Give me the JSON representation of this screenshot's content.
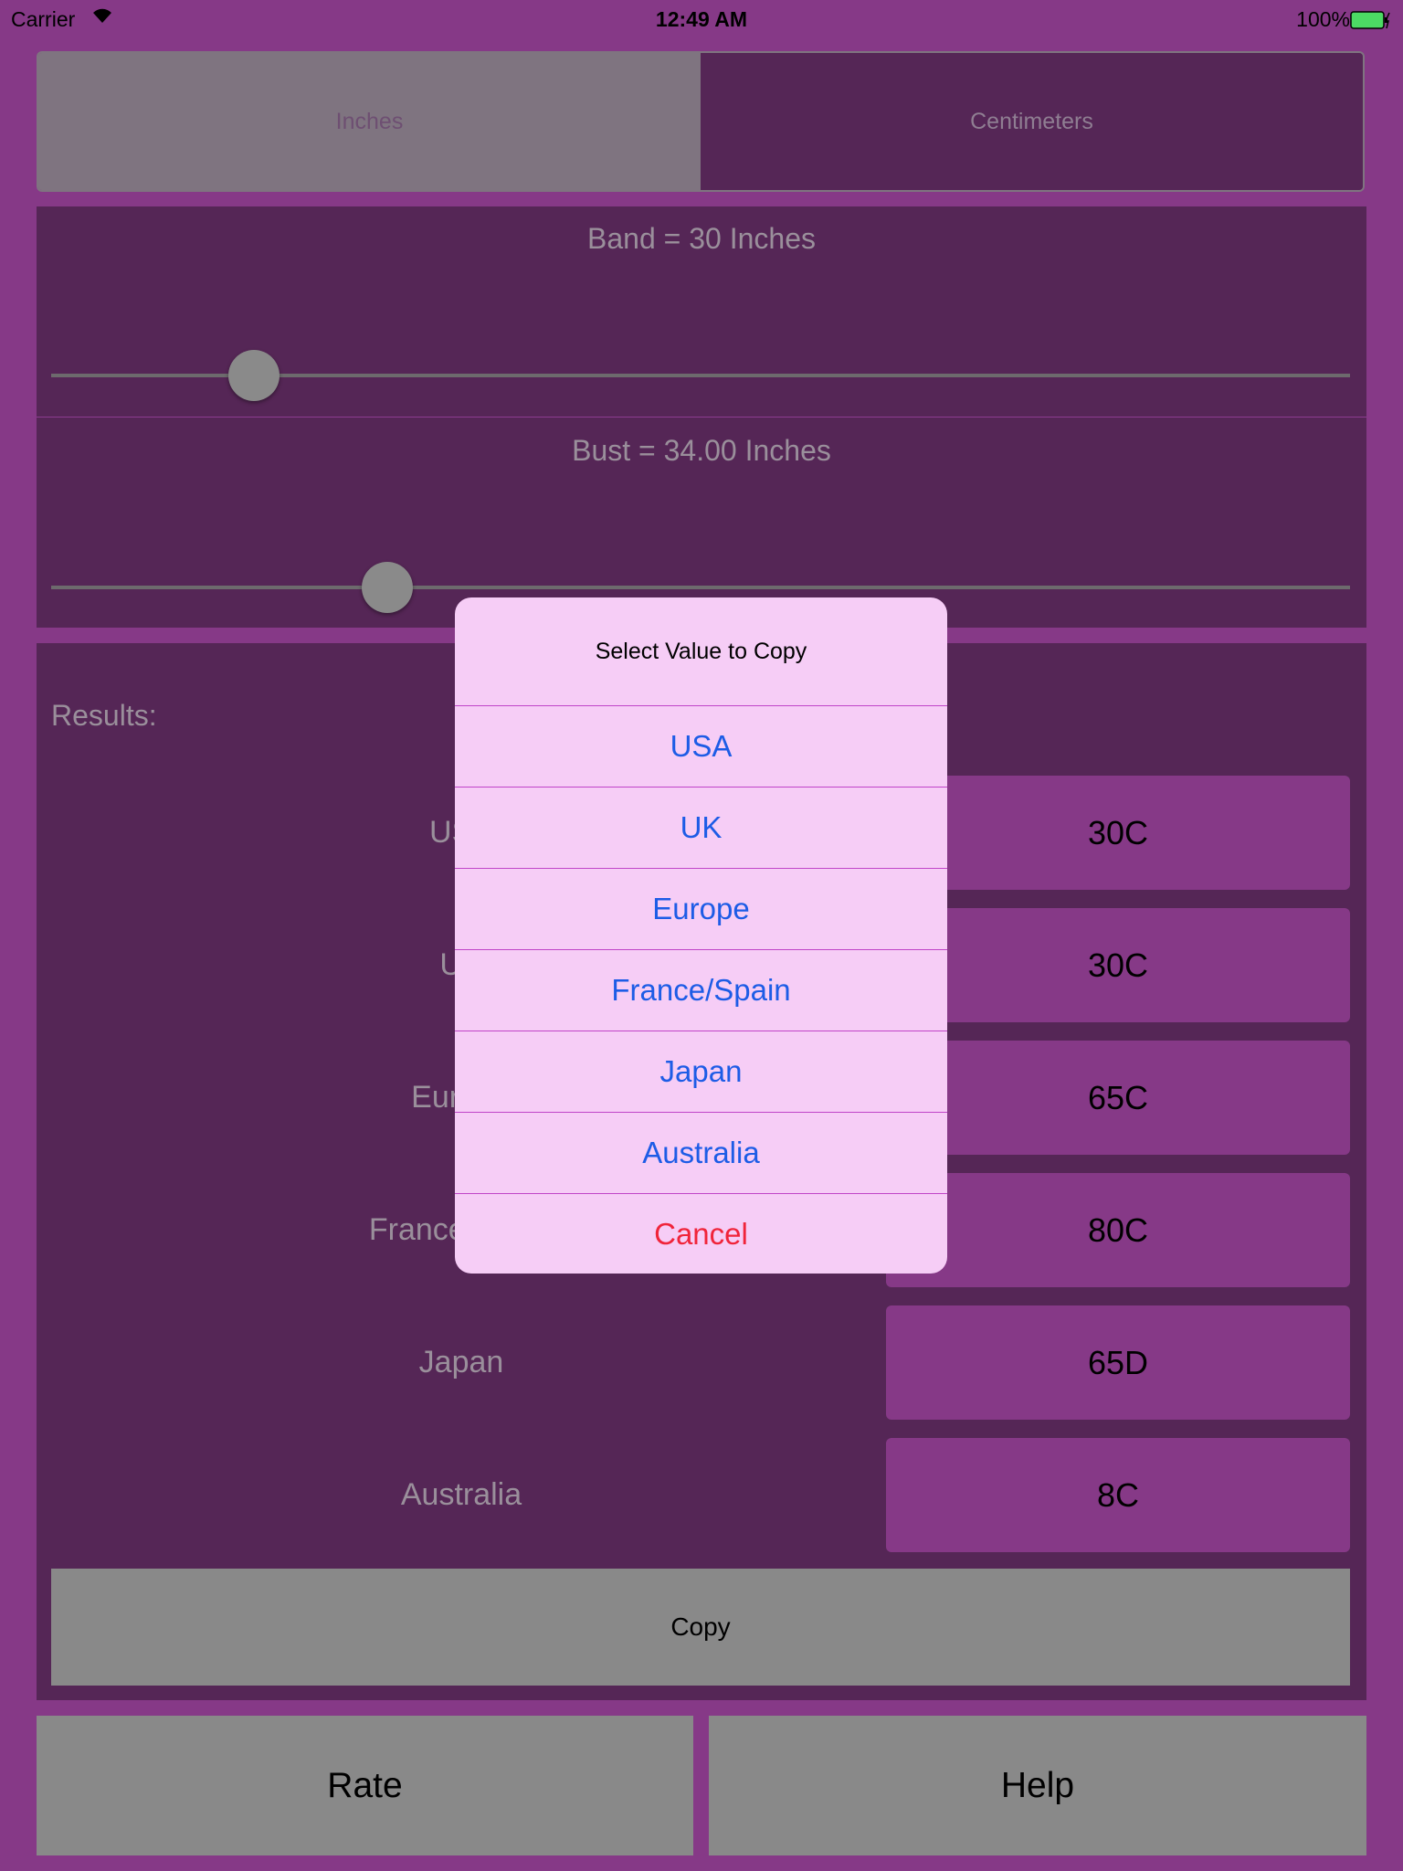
{
  "status": {
    "carrier": "Carrier",
    "time": "12:49 AM",
    "battery": "100%",
    "battery_color": "#4cd964"
  },
  "units": {
    "options": [
      "Inches",
      "Centimeters"
    ],
    "selected": "Inches"
  },
  "band": {
    "label": "Band = 30 Inches",
    "slider_fraction": 0.155
  },
  "bust": {
    "label": "Bust = 34.00 Inches",
    "slider_fraction": 0.258
  },
  "results": {
    "title": "Results:",
    "rows": [
      {
        "region": "USA",
        "size": "30C"
      },
      {
        "region": "UK",
        "size": "30C"
      },
      {
        "region": "Europe",
        "size": "65C"
      },
      {
        "region": "France/Spain",
        "size": "80C"
      },
      {
        "region": "Japan",
        "size": "65D"
      },
      {
        "region": "Australia",
        "size": "8C"
      }
    ]
  },
  "copy_label": "Copy",
  "rate_label": "Rate",
  "help_label": "Help",
  "dialog": {
    "title": "Select Value to Copy",
    "options": [
      "USA",
      "UK",
      "Europe",
      "France/Spain",
      "Japan",
      "Australia"
    ],
    "cancel": "Cancel"
  },
  "colors": {
    "background": "#863987",
    "panel": "#552656",
    "link": "#1d5ce6",
    "destructive": "#f0243a"
  }
}
